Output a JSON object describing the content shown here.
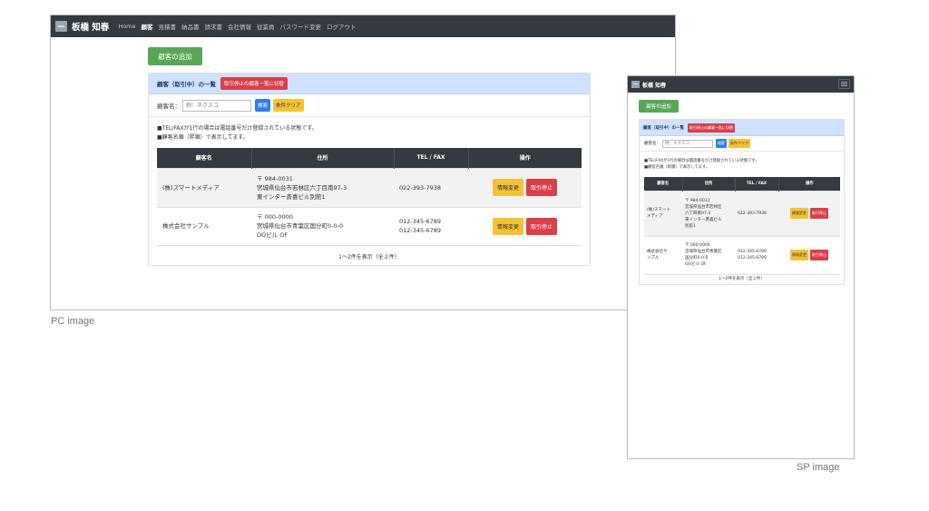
{
  "app": {
    "user_name": "板橋 知春",
    "nav_items": [
      "Home",
      "顧客",
      "見積書",
      "納品書",
      "請求書",
      "会社情報",
      "従業員",
      "パスワード変更",
      "ログアウト"
    ],
    "active_nav": "顧客"
  },
  "actions": {
    "add_customer": "顧客の追加"
  },
  "customer_list": {
    "title": "顧客（取引中）の一覧",
    "switch_to_stopped": "取引停止の顧客一覧に切替",
    "search_label": "顧客名：",
    "search_placeholder": "例：ネクスコ",
    "search_button": "検索",
    "clear_button": "条件クリア",
    "notes": [
      "■TEL/FAXが1行の場合は電話番号だけ登録されている状態です。",
      "■顧客名順（昇順）で表示してます。"
    ],
    "columns": [
      "顧客名",
      "住所",
      "TEL / FAX",
      "操作"
    ],
    "rows": [
      {
        "name": "(株)スマートメディア",
        "address": "〒 984-0031\n宮城県仙台市若林区六丁目南97-3\n東インター斎喜ビル別館1",
        "tel_fax": "022-393-7938",
        "edit": "情報変更",
        "stop": "取引停止"
      },
      {
        "name": "株式会社サンプル",
        "address": "〒 000-0000\n宮城県仙台市青葉区国分町0-0-0\nOOビル OF",
        "tel_fax": "012-345-6789\n012-345-6789",
        "edit": "情報変更",
        "stop": "取引停止"
      }
    ],
    "count_text": "1～2件を表示（全２件）"
  },
  "sp_rows_wrapped": [
    {
      "name": "(株)スマート\nメディア",
      "address": "〒 984-0031\n宮城県仙台市若林区\n六丁目南97-3\n東インター斎喜ビル\n別館1"
    },
    {
      "name": "株式会社サ\nンプル",
      "address": "〒 000-0000\n宮城県仙台市青葉区\n国分町0-0-0\nOOビル OF"
    }
  ],
  "captions": {
    "pc": "PC image",
    "sp": "SP image"
  },
  "colors": {
    "navbar": "#343a40",
    "success": "#5aa657",
    "danger": "#d9404b",
    "warning": "#f5c236",
    "primary": "#2f7fe8",
    "card_header": "#cfe2ff"
  }
}
